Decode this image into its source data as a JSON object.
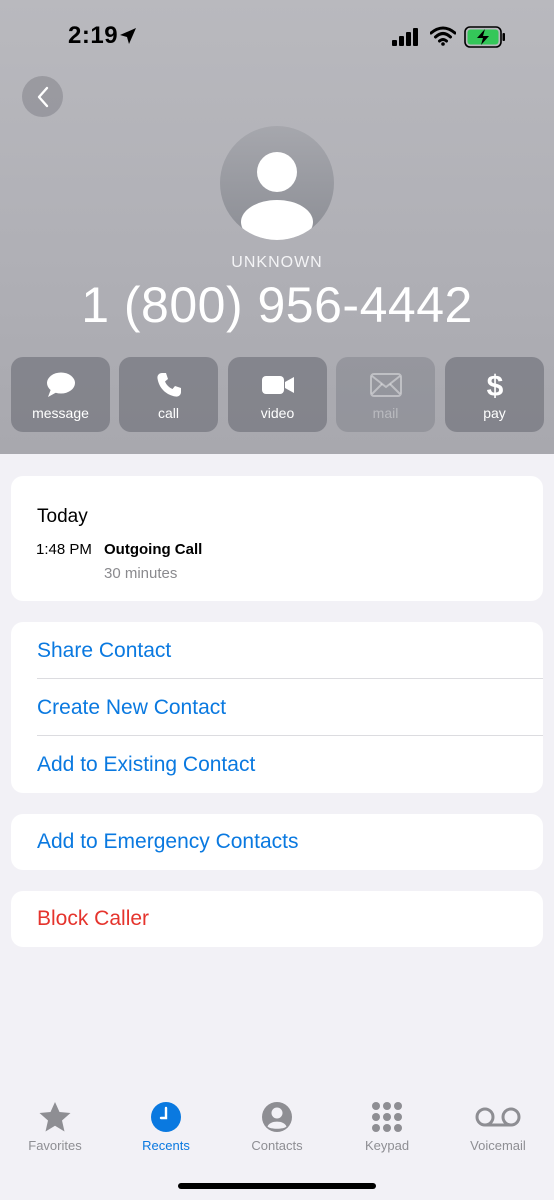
{
  "status_bar": {
    "time": "2:19"
  },
  "caller": {
    "label": "UNKNOWN",
    "number": "1 (800) 956-4442"
  },
  "actions": [
    {
      "label": "message",
      "icon": "message-icon",
      "enabled": true
    },
    {
      "label": "call",
      "icon": "phone-icon",
      "enabled": true
    },
    {
      "label": "video",
      "icon": "video-icon",
      "enabled": true
    },
    {
      "label": "mail",
      "icon": "mail-icon",
      "enabled": false
    },
    {
      "label": "pay",
      "icon": "dollar-icon",
      "enabled": true
    }
  ],
  "recents": {
    "day": "Today",
    "time": "1:48 PM",
    "type": "Outgoing Call",
    "duration": "30 minutes"
  },
  "contact_actions": [
    "Share Contact",
    "Create New Contact",
    "Add to Existing Contact"
  ],
  "emergency_action": "Add to Emergency Contacts",
  "block_action": "Block Caller",
  "tabs": [
    {
      "label": "Favorites",
      "icon": "star-icon",
      "active": false
    },
    {
      "label": "Recents",
      "icon": "clock-icon",
      "active": true
    },
    {
      "label": "Contacts",
      "icon": "person-circle-icon",
      "active": false
    },
    {
      "label": "Keypad",
      "icon": "keypad-icon",
      "active": false
    },
    {
      "label": "Voicemail",
      "icon": "voicemail-icon",
      "active": false
    }
  ],
  "colors": {
    "accent": "#0a79e0",
    "destructive": "#e5342d",
    "battery": "#34c759"
  }
}
